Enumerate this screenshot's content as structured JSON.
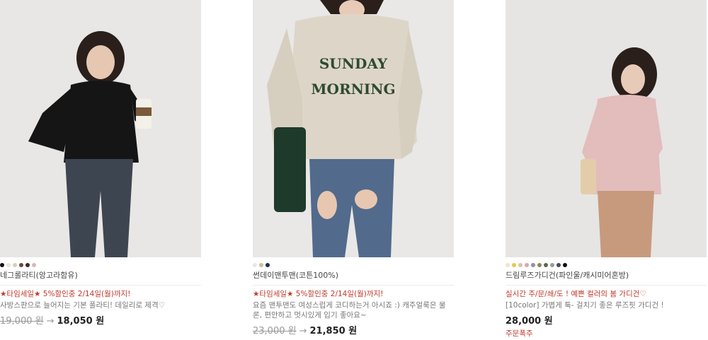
{
  "products": [
    {
      "swatches": [
        "#111111",
        "#e8e4da",
        "#d9cfbf",
        "#6b4a3a",
        "#3a2a22",
        "#d7b8b8"
      ],
      "name": "네그롤라티(앙고라함유)",
      "promo": "★타임세일★ 5%할인중 2/14일(월)까지!",
      "desc": "사방스판으로 늘어지는 기본 폴라티! 데일리로 제격♡",
      "old_price": "19,000 원",
      "arrow": "→",
      "new_price": "18,050 원"
    },
    {
      "swatches": [
        "#ece7dc",
        "#cdbf9b",
        "#1f2c4f"
      ],
      "name": "썬데이맨투맨(코튼100%)",
      "promo": "★타임세일★ 5%할인중 2/14일(월)까지!",
      "desc": "요즘 맨투맨도 여성스럽게 코디하는거 아시죠 :) 캐주얼룩은 물론, 편안하고 멋시있게 입기 좋아요~",
      "sweatshirt_text_1": "SUNDAY",
      "sweatshirt_text_2": "MORNING",
      "old_price": "23,000 원",
      "arrow": "→",
      "new_price": "21,850 원"
    },
    {
      "swatches": [
        "#f1e7c4",
        "#e8c84a",
        "#cfc6a8",
        "#d9a8a8",
        "#9b8aa8",
        "#8a8a5a",
        "#5a6a4a",
        "#9a9a9a",
        "#4a4a5a",
        "#111111"
      ],
      "name": "드림루즈가디건(파인울/캐시미어혼방)",
      "desc_red": "실시간 주/문/쇄/도 ! 예쁜 컬러의 봄 가디건♡",
      "desc": "[10color] 가볍게 툭- 걸치기 좋은 루즈핏 가디건 !",
      "price": "28,000 원",
      "order_tag": "주문폭주"
    }
  ]
}
